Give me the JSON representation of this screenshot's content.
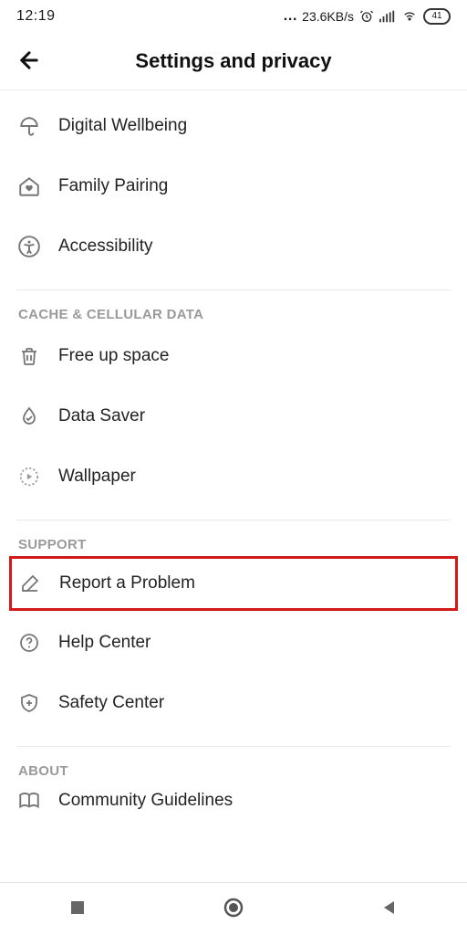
{
  "status": {
    "time": "12:19",
    "speed": "23.6KB/s",
    "battery": "41"
  },
  "header": {
    "title": "Settings and privacy"
  },
  "sections": {
    "general": {
      "items": {
        "digital_wellbeing": "Digital Wellbeing",
        "family_pairing": "Family Pairing",
        "accessibility": "Accessibility"
      }
    },
    "cache": {
      "title": "CACHE & CELLULAR DATA",
      "items": {
        "free_up_space": "Free up space",
        "data_saver": "Data Saver",
        "wallpaper": "Wallpaper"
      }
    },
    "support": {
      "title": "SUPPORT",
      "items": {
        "report_problem": "Report a Problem",
        "help_center": "Help Center",
        "safety_center": "Safety Center"
      }
    },
    "about": {
      "title": "ABOUT",
      "items": {
        "community_guidelines": "Community Guidelines"
      }
    }
  }
}
